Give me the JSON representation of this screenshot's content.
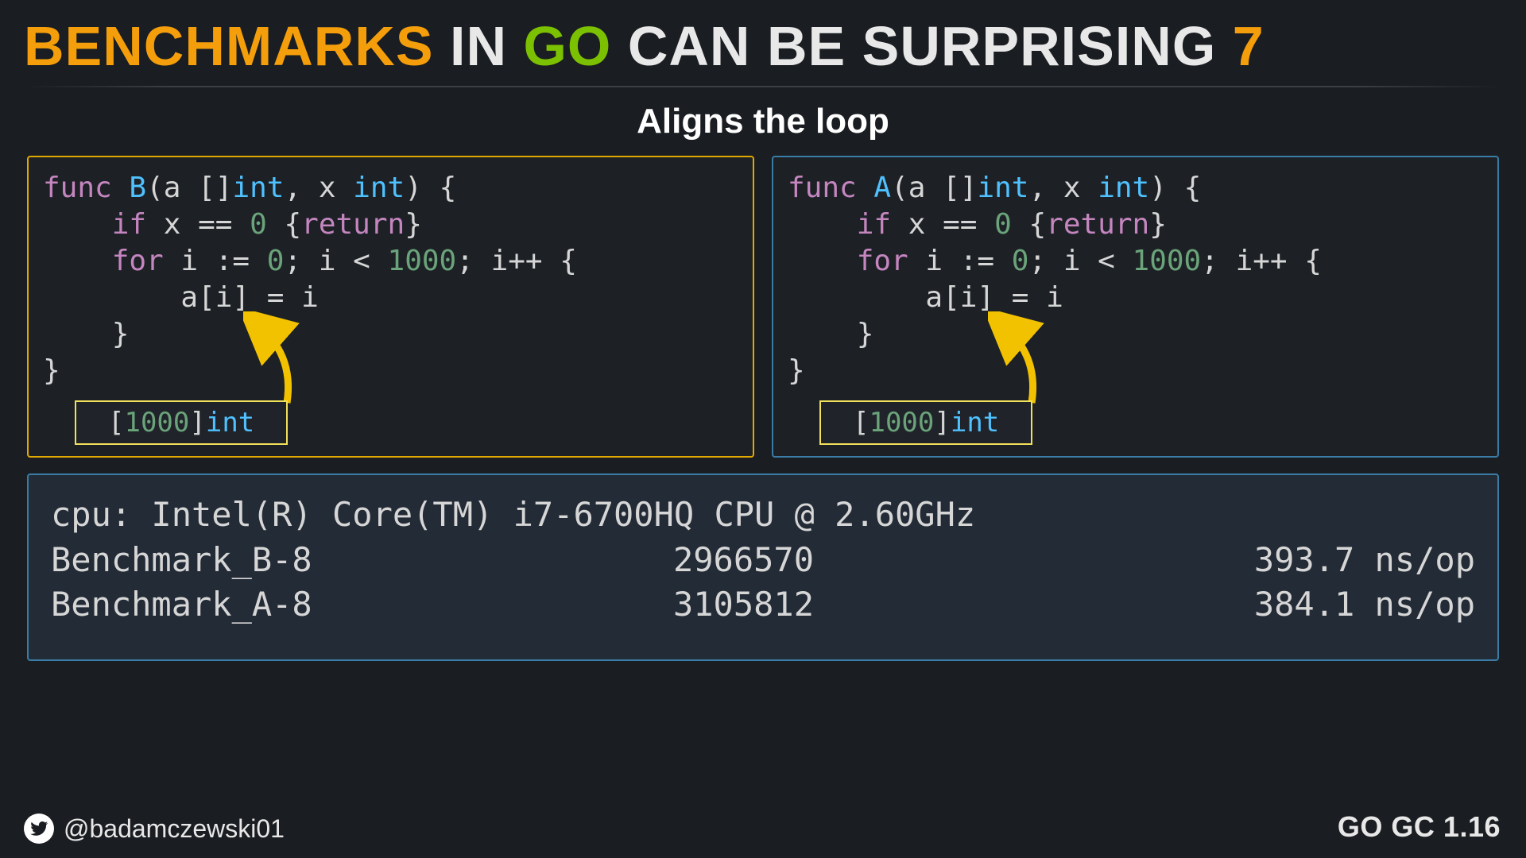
{
  "title": {
    "word1": "BENCHMARKS",
    "word2": "IN",
    "word3": "GO",
    "word4": "CAN",
    "word5": "BE",
    "word6": "SURPRISING",
    "num": "7"
  },
  "subtitle": "Aligns the loop",
  "code_left": {
    "fn_name": "B",
    "lines": {
      "l1_func": "func",
      "l1_open": "(a []",
      "l1_int1": "int",
      "l1_mid": ", x ",
      "l1_int2": "int",
      "l1_close": ") {",
      "l2_indent": "    ",
      "l2_if": "if",
      "l2_cond": " x == ",
      "l2_zero": "0",
      "l2_brace": " {",
      "l2_return": "return",
      "l2_end": "}",
      "l3_indent": "    ",
      "l3_for": "for",
      "l3_a": " i := ",
      "l3_zero": "0",
      "l3_b": "; i < ",
      "l3_thou": "1000",
      "l3_c": "; i++ {",
      "l4": "        a[i] = i",
      "l5": "    }",
      "l6": "}"
    },
    "callout": {
      "open": "[",
      "size": "1000",
      "close": "]",
      "type": "int"
    }
  },
  "code_right": {
    "fn_name": "A",
    "lines": {
      "l1_func": "func",
      "l1_open": "(a []",
      "l1_int1": "int",
      "l1_mid": ", x ",
      "l1_int2": "int",
      "l1_close": ") {",
      "l2_indent": "    ",
      "l2_if": "if",
      "l2_cond": " x == ",
      "l2_zero": "0",
      "l2_brace": " {",
      "l2_return": "return",
      "l2_end": "}",
      "l3_indent": "    ",
      "l3_for": "for",
      "l3_a": " i := ",
      "l3_zero": "0",
      "l3_b": "; i < ",
      "l3_thou": "1000",
      "l3_c": "; i++ {",
      "l4": "        a[i] = i",
      "l5": "    }",
      "l6": "}"
    },
    "callout": {
      "open": "[",
      "size": "1000",
      "close": "]",
      "type": "int"
    }
  },
  "bench": {
    "cpu": "cpu: Intel(R) Core(TM) i7-6700HQ CPU @ 2.60GHz",
    "rows": [
      {
        "name": "Benchmark_B-8",
        "iters": "2966570",
        "nsop": "393.7 ns/op"
      },
      {
        "name": "Benchmark_A-8",
        "iters": "3105812",
        "nsop": "384.1 ns/op"
      }
    ]
  },
  "footer": {
    "handle": "@badamczewski01",
    "version": "GO GC 1.16"
  },
  "colors": {
    "bg": "#1a1d21",
    "accent_orange": "#f59e0b",
    "accent_green": "#7cc002",
    "box_yellow": "#e0a800",
    "box_blue": "#3a7ca5",
    "callout_yellow": "#f1e05a"
  }
}
